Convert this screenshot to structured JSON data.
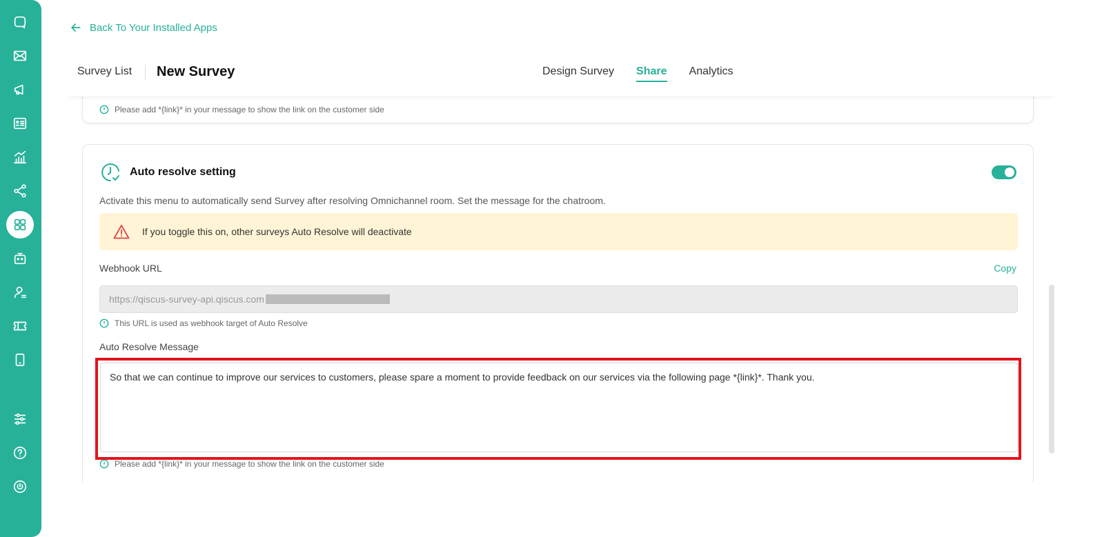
{
  "sidebar": {
    "icons": [
      "chat-icon",
      "mail-icon",
      "megaphone-icon",
      "contact-card-icon",
      "analytics-icon",
      "integration-icon",
      "apps-icon",
      "bot-icon",
      "agent-icon",
      "ticket-icon",
      "mobile-icon",
      "settings-icon",
      "help-icon",
      "power-icon"
    ]
  },
  "back_link": "Back To Your Installed Apps",
  "header": {
    "breadcrumb": "Survey List",
    "title": "New Survey",
    "tabs": [
      {
        "label": "Design Survey",
        "active": false
      },
      {
        "label": "Share",
        "active": true
      },
      {
        "label": "Analytics",
        "active": false
      }
    ]
  },
  "top_card": {
    "hint": "Please add *{link}* in your message to show the link on the customer side"
  },
  "auto_resolve": {
    "title": "Auto resolve setting",
    "enabled": true,
    "description": "Activate this menu to automatically send Survey after resolving Omnichannel room. Set the message for the chatroom.",
    "warning": "If you toggle this on, other surveys Auto Resolve will deactivate",
    "webhook_label": "Webhook URL",
    "copy_label": "Copy",
    "webhook_value": "https://qiscus-survey-api.qiscus.com",
    "webhook_hint": "This URL is used as webhook target of Auto Resolve",
    "message_label": "Auto Resolve Message",
    "message_value": "So that we can continue to improve our services to customers, please spare a moment to provide feedback on our services via the following page *{link}*. Thank you.",
    "message_hint": "Please add *{link}* in your message to show the link on the customer side"
  },
  "colors": {
    "accent": "#27b199",
    "warning_bg": "#fff4d6",
    "warning_icon": "#e04545",
    "highlight": "#e3141b"
  }
}
